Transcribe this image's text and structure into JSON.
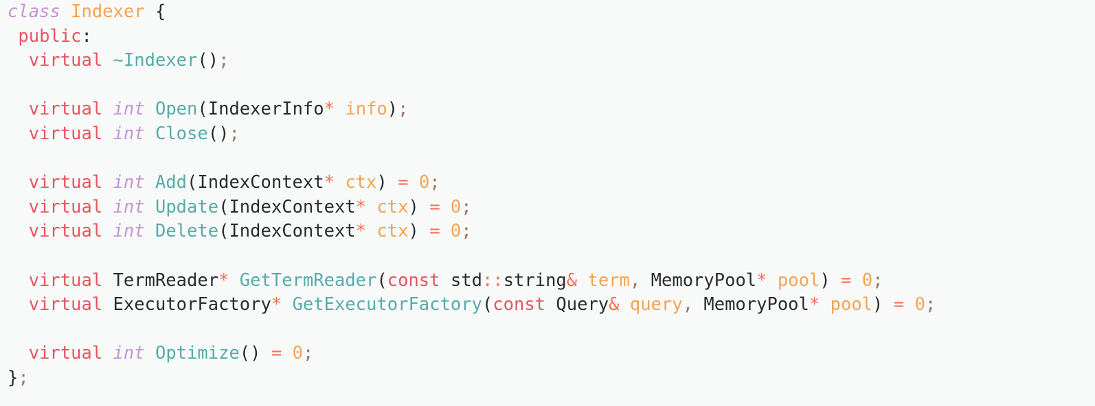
{
  "editor": {
    "language": "C++",
    "background_color": "#f8faf9",
    "font_size_px": 25.5,
    "line_height_px": 35.6,
    "indent_guide_color": "#cfd6d3",
    "palette": {
      "keyword": "#e8545f",
      "storage_italic": "#c792d8",
      "type": "#2b2b2b",
      "function": "#56abab",
      "entity_name": "#f5a352",
      "parameter": "#f5a352",
      "number": "#f5a352",
      "operator": "#fa6e55",
      "punctuation": "#2b2b2b",
      "semicolon": "#9e7460"
    }
  },
  "code": {
    "plain_text": "class Indexer {\n public:\n  virtual ~Indexer();\n\n  virtual int Open(IndexerInfo* info);\n  virtual int Close();\n\n  virtual int Add(IndexContext* ctx) = 0;\n  virtual int Update(IndexContext* ctx) = 0;\n  virtual int Delete(IndexContext* ctx) = 0;\n\n  virtual TermReader* GetTermReader(const std::string& term, MemoryPool* pool) = 0;\n  virtual ExecutorFactory* GetExecutorFactory(const Query& query, MemoryPool* pool) = 0;\n\n  virtual int Optimize() = 0;\n};",
    "lines": [
      {
        "n": 1,
        "indent": "",
        "tokens": [
          {
            "t": "class",
            "c": "tok-storage"
          },
          {
            "t": " ",
            "c": "tok-plain"
          },
          {
            "t": "Indexer",
            "c": "tok-entity"
          },
          {
            "t": " ",
            "c": "tok-plain"
          },
          {
            "t": "{",
            "c": "tok-punct"
          }
        ]
      },
      {
        "n": 2,
        "indent": " ",
        "tokens": [
          {
            "t": "public",
            "c": "tok-keyword"
          },
          {
            "t": ":",
            "c": "tok-punct"
          }
        ]
      },
      {
        "n": 3,
        "indent": "  ",
        "tokens": [
          {
            "t": "virtual",
            "c": "tok-keyword"
          },
          {
            "t": " ",
            "c": "tok-plain"
          },
          {
            "t": "~Indexer",
            "c": "tok-func"
          },
          {
            "t": "()",
            "c": "tok-punct"
          },
          {
            "t": ";",
            "c": "tok-semi"
          }
        ]
      },
      {
        "n": 4,
        "indent": "",
        "tokens": []
      },
      {
        "n": 5,
        "indent": "  ",
        "tokens": [
          {
            "t": "virtual",
            "c": "tok-keyword"
          },
          {
            "t": " ",
            "c": "tok-plain"
          },
          {
            "t": "int",
            "c": "tok-storage"
          },
          {
            "t": " ",
            "c": "tok-plain"
          },
          {
            "t": "Open",
            "c": "tok-func"
          },
          {
            "t": "(",
            "c": "tok-punct"
          },
          {
            "t": "IndexerInfo",
            "c": "tok-type"
          },
          {
            "t": "*",
            "c": "tok-operator"
          },
          {
            "t": " ",
            "c": "tok-plain"
          },
          {
            "t": "info",
            "c": "tok-param"
          },
          {
            "t": ")",
            "c": "tok-punct"
          },
          {
            "t": ";",
            "c": "tok-semi"
          }
        ]
      },
      {
        "n": 6,
        "indent": "  ",
        "tokens": [
          {
            "t": "virtual",
            "c": "tok-keyword"
          },
          {
            "t": " ",
            "c": "tok-plain"
          },
          {
            "t": "int",
            "c": "tok-storage"
          },
          {
            "t": " ",
            "c": "tok-plain"
          },
          {
            "t": "Close",
            "c": "tok-func"
          },
          {
            "t": "()",
            "c": "tok-punct"
          },
          {
            "t": ";",
            "c": "tok-semi"
          }
        ]
      },
      {
        "n": 7,
        "indent": "",
        "tokens": []
      },
      {
        "n": 8,
        "indent": "  ",
        "tokens": [
          {
            "t": "virtual",
            "c": "tok-keyword"
          },
          {
            "t": " ",
            "c": "tok-plain"
          },
          {
            "t": "int",
            "c": "tok-storage"
          },
          {
            "t": " ",
            "c": "tok-plain"
          },
          {
            "t": "Add",
            "c": "tok-func"
          },
          {
            "t": "(",
            "c": "tok-punct"
          },
          {
            "t": "IndexContext",
            "c": "tok-type"
          },
          {
            "t": "*",
            "c": "tok-operator"
          },
          {
            "t": " ",
            "c": "tok-plain"
          },
          {
            "t": "ctx",
            "c": "tok-param"
          },
          {
            "t": ")",
            "c": "tok-punct"
          },
          {
            "t": " ",
            "c": "tok-plain"
          },
          {
            "t": "=",
            "c": "tok-operator"
          },
          {
            "t": " ",
            "c": "tok-plain"
          },
          {
            "t": "0",
            "c": "tok-number"
          },
          {
            "t": ";",
            "c": "tok-semi"
          }
        ]
      },
      {
        "n": 9,
        "indent": "  ",
        "tokens": [
          {
            "t": "virtual",
            "c": "tok-keyword"
          },
          {
            "t": " ",
            "c": "tok-plain"
          },
          {
            "t": "int",
            "c": "tok-storage"
          },
          {
            "t": " ",
            "c": "tok-plain"
          },
          {
            "t": "Update",
            "c": "tok-func"
          },
          {
            "t": "(",
            "c": "tok-punct"
          },
          {
            "t": "IndexContext",
            "c": "tok-type"
          },
          {
            "t": "*",
            "c": "tok-operator"
          },
          {
            "t": " ",
            "c": "tok-plain"
          },
          {
            "t": "ctx",
            "c": "tok-param"
          },
          {
            "t": ")",
            "c": "tok-punct"
          },
          {
            "t": " ",
            "c": "tok-plain"
          },
          {
            "t": "=",
            "c": "tok-operator"
          },
          {
            "t": " ",
            "c": "tok-plain"
          },
          {
            "t": "0",
            "c": "tok-number"
          },
          {
            "t": ";",
            "c": "tok-semi"
          }
        ]
      },
      {
        "n": 10,
        "indent": "  ",
        "tokens": [
          {
            "t": "virtual",
            "c": "tok-keyword"
          },
          {
            "t": " ",
            "c": "tok-plain"
          },
          {
            "t": "int",
            "c": "tok-storage"
          },
          {
            "t": " ",
            "c": "tok-plain"
          },
          {
            "t": "Delete",
            "c": "tok-func"
          },
          {
            "t": "(",
            "c": "tok-punct"
          },
          {
            "t": "IndexContext",
            "c": "tok-type"
          },
          {
            "t": "*",
            "c": "tok-operator"
          },
          {
            "t": " ",
            "c": "tok-plain"
          },
          {
            "t": "ctx",
            "c": "tok-param"
          },
          {
            "t": ")",
            "c": "tok-punct"
          },
          {
            "t": " ",
            "c": "tok-plain"
          },
          {
            "t": "=",
            "c": "tok-operator"
          },
          {
            "t": " ",
            "c": "tok-plain"
          },
          {
            "t": "0",
            "c": "tok-number"
          },
          {
            "t": ";",
            "c": "tok-semi"
          }
        ]
      },
      {
        "n": 11,
        "indent": "",
        "tokens": []
      },
      {
        "n": 12,
        "indent": "  ",
        "tokens": [
          {
            "t": "virtual",
            "c": "tok-keyword"
          },
          {
            "t": " ",
            "c": "tok-plain"
          },
          {
            "t": "TermReader",
            "c": "tok-type"
          },
          {
            "t": "*",
            "c": "tok-operator"
          },
          {
            "t": " ",
            "c": "tok-plain"
          },
          {
            "t": "GetTermReader",
            "c": "tok-func"
          },
          {
            "t": "(",
            "c": "tok-punct"
          },
          {
            "t": "const",
            "c": "tok-keyword"
          },
          {
            "t": " ",
            "c": "tok-plain"
          },
          {
            "t": "std",
            "c": "tok-type"
          },
          {
            "t": "::",
            "c": "tok-operator"
          },
          {
            "t": "string",
            "c": "tok-type"
          },
          {
            "t": "&",
            "c": "tok-operator"
          },
          {
            "t": " ",
            "c": "tok-plain"
          },
          {
            "t": "term",
            "c": "tok-param"
          },
          {
            "t": ",",
            "c": "tok-semi"
          },
          {
            "t": " ",
            "c": "tok-plain"
          },
          {
            "t": "MemoryPool",
            "c": "tok-type"
          },
          {
            "t": "*",
            "c": "tok-operator"
          },
          {
            "t": " ",
            "c": "tok-plain"
          },
          {
            "t": "pool",
            "c": "tok-param"
          },
          {
            "t": ")",
            "c": "tok-punct"
          },
          {
            "t": " ",
            "c": "tok-plain"
          },
          {
            "t": "=",
            "c": "tok-operator"
          },
          {
            "t": " ",
            "c": "tok-plain"
          },
          {
            "t": "0",
            "c": "tok-number"
          },
          {
            "t": ";",
            "c": "tok-semi"
          }
        ]
      },
      {
        "n": 13,
        "indent": "  ",
        "tokens": [
          {
            "t": "virtual",
            "c": "tok-keyword"
          },
          {
            "t": " ",
            "c": "tok-plain"
          },
          {
            "t": "ExecutorFactory",
            "c": "tok-type"
          },
          {
            "t": "*",
            "c": "tok-operator"
          },
          {
            "t": " ",
            "c": "tok-plain"
          },
          {
            "t": "GetExecutorFactory",
            "c": "tok-func"
          },
          {
            "t": "(",
            "c": "tok-punct"
          },
          {
            "t": "const",
            "c": "tok-keyword"
          },
          {
            "t": " ",
            "c": "tok-plain"
          },
          {
            "t": "Query",
            "c": "tok-type"
          },
          {
            "t": "&",
            "c": "tok-operator"
          },
          {
            "t": " ",
            "c": "tok-plain"
          },
          {
            "t": "query",
            "c": "tok-param"
          },
          {
            "t": ",",
            "c": "tok-semi"
          },
          {
            "t": " ",
            "c": "tok-plain"
          },
          {
            "t": "MemoryPool",
            "c": "tok-type"
          },
          {
            "t": "*",
            "c": "tok-operator"
          },
          {
            "t": " ",
            "c": "tok-plain"
          },
          {
            "t": "pool",
            "c": "tok-param"
          },
          {
            "t": ")",
            "c": "tok-punct"
          },
          {
            "t": " ",
            "c": "tok-plain"
          },
          {
            "t": "=",
            "c": "tok-operator"
          },
          {
            "t": " ",
            "c": "tok-plain"
          },
          {
            "t": "0",
            "c": "tok-number"
          },
          {
            "t": ";",
            "c": "tok-semi"
          }
        ]
      },
      {
        "n": 14,
        "indent": "",
        "tokens": []
      },
      {
        "n": 15,
        "indent": "  ",
        "tokens": [
          {
            "t": "virtual",
            "c": "tok-keyword"
          },
          {
            "t": " ",
            "c": "tok-plain"
          },
          {
            "t": "int",
            "c": "tok-storage"
          },
          {
            "t": " ",
            "c": "tok-plain"
          },
          {
            "t": "Optimize",
            "c": "tok-func"
          },
          {
            "t": "()",
            "c": "tok-punct"
          },
          {
            "t": " ",
            "c": "tok-plain"
          },
          {
            "t": "=",
            "c": "tok-operator"
          },
          {
            "t": " ",
            "c": "tok-plain"
          },
          {
            "t": "0",
            "c": "tok-number"
          },
          {
            "t": ";",
            "c": "tok-semi"
          }
        ]
      },
      {
        "n": 16,
        "indent": "",
        "tokens": [
          {
            "t": "}",
            "c": "tok-punct"
          },
          {
            "t": ";",
            "c": "tok-semi"
          }
        ]
      }
    ]
  }
}
